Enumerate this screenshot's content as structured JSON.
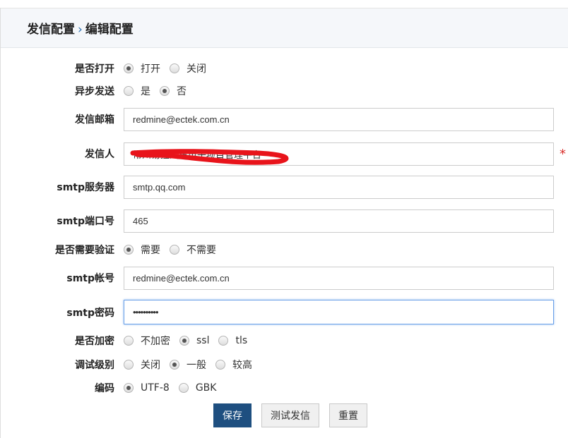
{
  "breadcrumb": {
    "parent": "发信配置",
    "separator": "›",
    "current": "编辑配置"
  },
  "fields": {
    "enable": {
      "label": "是否打开",
      "options": [
        "打开",
        "关闭"
      ],
      "selected": 0
    },
    "async": {
      "label": "异步发送",
      "options": [
        "是",
        "否"
      ],
      "selected": 1
    },
    "sender_email": {
      "label": "发信邮箱",
      "value": "redmine@ectek.com.cn"
    },
    "sender_name": {
      "label": "发信人",
      "value": "常州易控汽车电子项目管理平台",
      "required": "*"
    },
    "smtp_server": {
      "label": "smtp服务器",
      "value": "smtp.qq.com"
    },
    "smtp_port": {
      "label": "smtp端口号",
      "value": "465"
    },
    "auth": {
      "label": "是否需要验证",
      "options": [
        "需要",
        "不需要"
      ],
      "selected": 0
    },
    "smtp_account": {
      "label": "smtp帐号",
      "value": "redmine@ectek.com.cn"
    },
    "smtp_password": {
      "label": "smtp密码",
      "value": "••••••••••"
    },
    "encrypt": {
      "label": "是否加密",
      "options": [
        "不加密",
        "ssl",
        "tls"
      ],
      "selected": 1
    },
    "debug": {
      "label": "调试级别",
      "options": [
        "关闭",
        "一般",
        "较高"
      ],
      "selected": 1
    },
    "encoding": {
      "label": "编码",
      "options": [
        "UTF-8",
        "GBK"
      ],
      "selected": 0
    }
  },
  "buttons": {
    "save": "保存",
    "test": "测试发信",
    "reset": "重置"
  },
  "colors": {
    "primary": "#1e4f80",
    "required": "#d9302c"
  }
}
